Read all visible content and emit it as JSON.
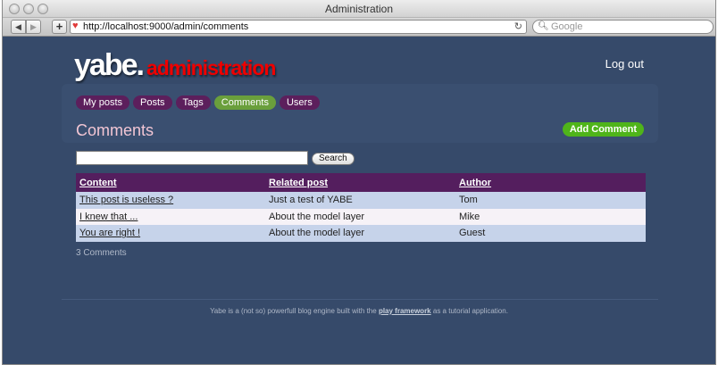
{
  "window": {
    "title": "Administration"
  },
  "toolbar": {
    "url": "http://localhost:9000/admin/comments",
    "search_placeholder": "Google",
    "back_glyph": "◀",
    "forward_glyph": "▶",
    "plus_glyph": "+",
    "reload_glyph": "↻"
  },
  "header": {
    "brand": "yabe.",
    "subtitle": "administration",
    "logout_label": "Log out"
  },
  "nav": {
    "tabs": [
      {
        "label": "My posts"
      },
      {
        "label": "Posts"
      },
      {
        "label": "Tags"
      },
      {
        "label": "Comments",
        "active": true
      },
      {
        "label": "Users"
      }
    ]
  },
  "main": {
    "title": "Comments",
    "add_label": "Add Comment",
    "search": {
      "value": "",
      "button_label": "Search"
    },
    "table": {
      "headers": [
        "Content",
        "Related post",
        "Author"
      ],
      "rows": [
        {
          "content": "This post is useless ?",
          "post": "Just a test of YABE",
          "author": "Tom"
        },
        {
          "content": "I knew that ...",
          "post": "About the model layer",
          "author": "Mike"
        },
        {
          "content": "You are right !",
          "post": "About the model layer",
          "author": "Guest"
        }
      ]
    },
    "count_text": "3 Comments"
  },
  "footer": {
    "prefix": "Yabe is a (not so) powerfull blog engine built with the",
    "link": "play framework",
    "suffix": "as a tutorial application."
  },
  "colors": {
    "page_bg": "#364a6a",
    "tab_bg": "#5c1f5c",
    "tab_active_bg": "#6a9f3c",
    "add_button_bg": "#4fb41a",
    "table_header_bg": "#541e5e",
    "row_odd_bg": "#c6d3ea",
    "row_even_bg": "#f6f2f7",
    "heading_color": "#f2c6d4",
    "brand_sub_color": "#ee0000"
  }
}
